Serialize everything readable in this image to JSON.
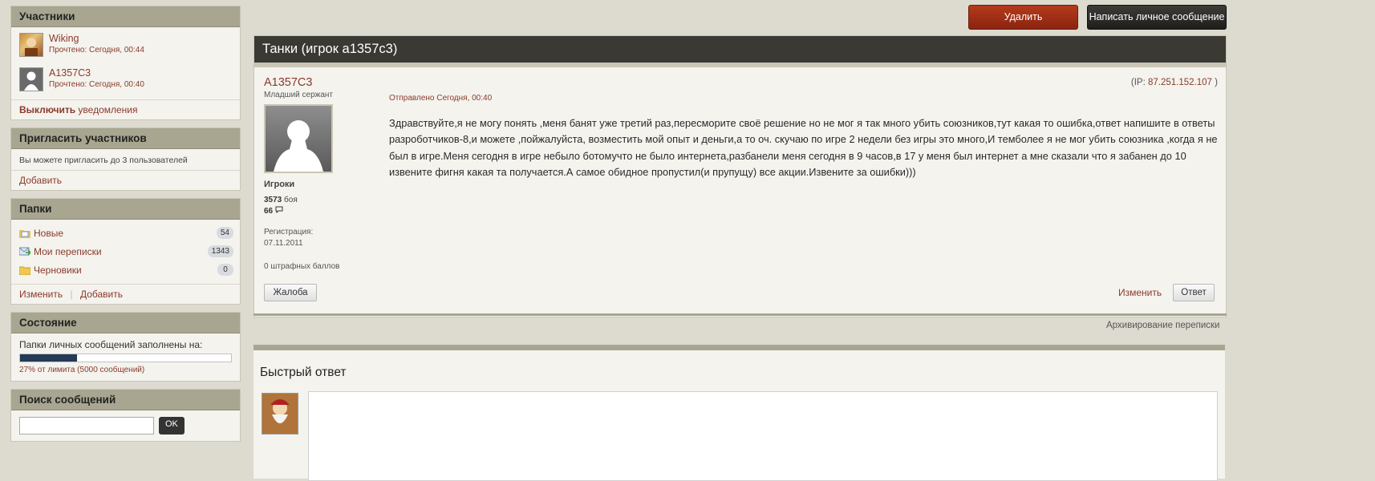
{
  "sidebar": {
    "participants": {
      "title": "Участники",
      "items": [
        {
          "name": "Wiking",
          "read": "Прочтено: Сегодня, 00:44"
        },
        {
          "name": "A1357C3",
          "read": "Прочтено: Сегодня, 00:40"
        }
      ],
      "unsubscribe_bold": "Выключить",
      "unsubscribe_rest": "уведомления"
    },
    "invite": {
      "title": "Пригласить участников",
      "text": "Вы можете пригласить до 3 пользователей",
      "add": "Добавить"
    },
    "folders": {
      "title": "Папки",
      "items": [
        {
          "name": "Новые",
          "count": "54"
        },
        {
          "name": "Мои переписки",
          "count": "1343"
        },
        {
          "name": "Черновики",
          "count": "0"
        }
      ],
      "edit": "Изменить",
      "add": "Добавить"
    },
    "status": {
      "title": "Состояние",
      "label": "Папки личных сообщений заполнены на:",
      "percent_fill": 0.27,
      "caption": "27% от лимита (5000 сообщений)"
    },
    "search": {
      "title": "Поиск сообщений",
      "ok": "OK"
    }
  },
  "toolbar": {
    "delete": "Удалить",
    "write_pm": "Написать личное сообщение"
  },
  "thread": {
    "title": "Танки (игрок а1357с3)",
    "author": {
      "name": "A1357C3",
      "rank": "Младший сержант",
      "group": "Игроки",
      "battles_num": "3573",
      "battles_label": "боя",
      "posts_num": "66",
      "reg_label": "Регистрация:",
      "reg_date": "07.11.2011",
      "penalty": "0 штрафных баллов"
    },
    "sent": "Отправлено Сегодня, 00:40",
    "ip_label": "(IP:",
    "ip_value": "87.251.152.107",
    "ip_close": ")",
    "message": "Здравствуйте,я не могу понять ,меня банят уже третий раз,пересморите своё решение но не мог я так много убить союзников,тут какая то ошибка,ответ напишите в ответы разроботчиков-8,и можете ,пойжалуйста, возместить мой опыт и деньги,а то оч. скучаю по игре 2 недели без игры это много,И темболее я не мог убить союзника ,когда я не был в игре.Меня сегодня в игре небыло ботомучто не было интернета,разбанели меня сегодня в 9 часов,в 17 у меня был интернет а мне сказали что я забанен до 10 извените фигня какая та получается.А самое обидное пропустил(и прупущу) все акции.Извените за ошибки)))",
    "complaint": "Жалоба",
    "edit": "Изменить",
    "reply": "Ответ"
  },
  "archive": "Архивирование переписки",
  "quick_reply": {
    "title": "Быстрый ответ"
  }
}
